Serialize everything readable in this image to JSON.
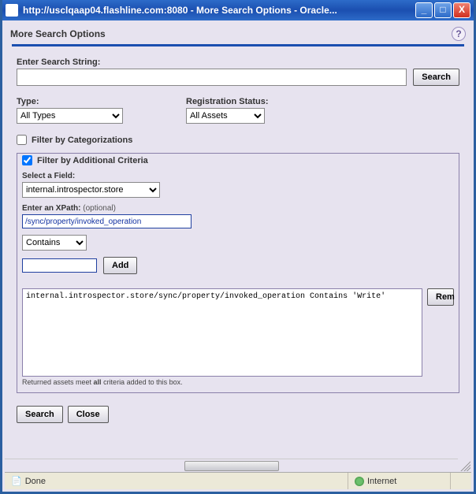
{
  "window": {
    "title": "http://usclqaap04.flashline.com:8080 - More Search Options - Oracle...",
    "min_glyph": "_",
    "max_glyph": "□",
    "close_glyph": "X"
  },
  "header": {
    "title": "More Search Options",
    "help_glyph": "?"
  },
  "search": {
    "label": "Enter Search String:",
    "value": "",
    "button": "Search"
  },
  "type": {
    "label": "Type:",
    "selected": "All Types"
  },
  "reg_status": {
    "label": "Registration Status:",
    "selected": "All Assets"
  },
  "filter_cat": {
    "checked": false,
    "label": "Filter by Categorizations"
  },
  "filter_add": {
    "checked": true,
    "label": "Filter by Additional Criteria",
    "select_field_label": "Select a Field:",
    "select_field_value": "internal.introspector.store",
    "xpath_label": "Enter an XPath:",
    "xpath_hint": " (optional)",
    "xpath_value": "/sync/property/invoked_operation",
    "operator_value": "Contains",
    "value_input": "",
    "add_button": "Add",
    "criteria_text": "internal.introspector.store/sync/property/invoked_operation Contains 'Write'",
    "remove_button": "Rem",
    "footnote_pre": "Returned assets meet ",
    "footnote_bold": "all",
    "footnote_post": " criteria added to this box."
  },
  "bottom": {
    "search": "Search",
    "close": "Close"
  },
  "status": {
    "done": "Done",
    "zone": "Internet"
  }
}
